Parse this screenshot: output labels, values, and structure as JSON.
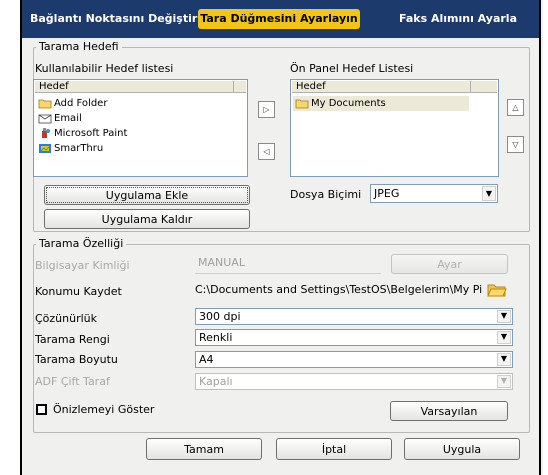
{
  "tabs": [
    {
      "label": "Bağlantı Noktasını Değiştir"
    },
    {
      "label": "Tara Düğmesini Ayarlayın"
    },
    {
      "label": "Faks Alımını Ayarla"
    }
  ],
  "scan_destination": {
    "legend": "Tarama Hedefi",
    "available": {
      "title": "Kullanılabilir Hedef listesi",
      "column": "Hedef",
      "items": [
        {
          "label": "Add Folder",
          "icon": "folder-icon"
        },
        {
          "label": "Email",
          "icon": "email-icon"
        },
        {
          "label": "Microsoft Paint",
          "icon": "paint-icon"
        },
        {
          "label": "SmarThru",
          "icon": "smarthru-icon"
        }
      ]
    },
    "front_panel": {
      "title": "Ön Panel Hedef Listesi",
      "column": "Hedef",
      "items": [
        {
          "label": "My Documents",
          "icon": "folder-icon"
        }
      ]
    },
    "add_app_label": "Uygulama Ekle",
    "remove_app_label": "Uygulama Kaldır",
    "file_format_label": "Dosya Biçimi",
    "file_format_value": "JPEG"
  },
  "scan_properties": {
    "legend": "Tarama Özelliği",
    "computer_id_label": "Bilgisayar Kimliği",
    "computer_id_value": "MANUAL",
    "set_button": "Ayar",
    "save_location_label": "Konumu Kaydet",
    "save_location_value": "C:\\Documents and Settings\\TestOS\\Belgelerim\\My Pict",
    "resolution_label": "Çözünürlük",
    "resolution_value": "300 dpi",
    "color_label": "Tarama Rengi",
    "color_value": "Renkli",
    "size_label": "Tarama Boyutu",
    "size_value": "A4",
    "adf_label": "ADF Çift Taraf",
    "adf_value": "Kapalı",
    "preview_label": "Önizlemeyi Göster",
    "defaults_button": "Varsayılan"
  },
  "footer": {
    "ok": "Tamam",
    "cancel": "İptal",
    "apply": "Uygula"
  },
  "colors": {
    "tab_bar": "#1d3a6d",
    "active_tab": "#f3c316"
  }
}
